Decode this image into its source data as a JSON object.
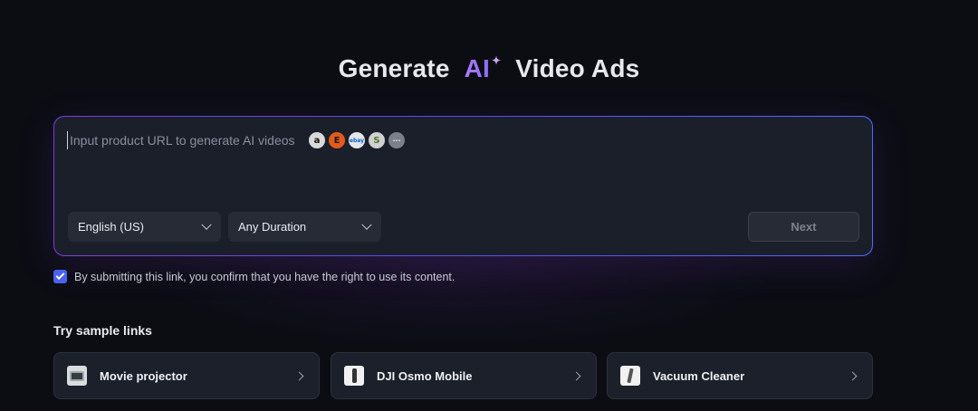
{
  "header": {
    "title_prefix": "Generate",
    "title_ai": "AI",
    "title_sparkle": "✦",
    "title_suffix": "Video Ads"
  },
  "url_input": {
    "placeholder": "Input product URL to generate AI videos",
    "value": "",
    "store_icons": [
      {
        "name": "amazon-icon",
        "glyph": "a"
      },
      {
        "name": "etsy-icon",
        "glyph": "E"
      },
      {
        "name": "ebay-icon",
        "glyph": "ebay"
      },
      {
        "name": "shopify-icon",
        "glyph": "S"
      },
      {
        "name": "more-icon",
        "glyph": "···"
      }
    ]
  },
  "controls": {
    "language": "English (US)",
    "duration": "Any Duration",
    "next_label": "Next"
  },
  "consent": {
    "checked": true,
    "text": "By submitting this link, you confirm that you have the right to use its content."
  },
  "samples": {
    "title": "Try sample links",
    "items": [
      {
        "label": "Movie projector"
      },
      {
        "label": "DJI Osmo Mobile"
      },
      {
        "label": "Vacuum Cleaner"
      }
    ]
  },
  "colors": {
    "background": "#0b0d13",
    "accent": "#8a6bff",
    "checkbox": "#4a63f0"
  }
}
